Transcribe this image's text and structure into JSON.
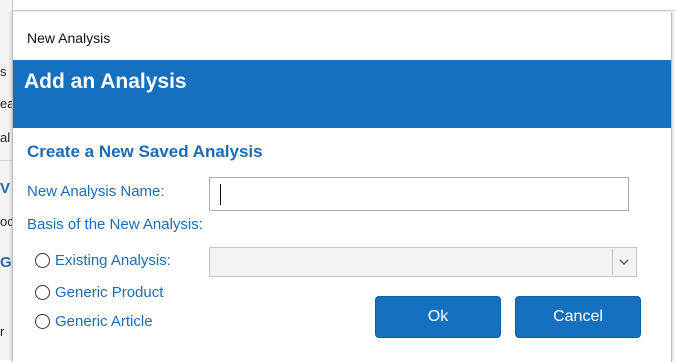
{
  "window": {
    "title": "New Analysis"
  },
  "header": {
    "title": "Add an Analysis"
  },
  "form": {
    "section_title": "Create a New Saved Analysis",
    "name_label": "New Analysis Name:",
    "name_value": "",
    "basis_label": "Basis of the New Analysis:",
    "options": [
      {
        "label": "Existing Analysis:",
        "selected": false
      },
      {
        "label": "Generic Product",
        "selected": false
      },
      {
        "label": "Generic Article",
        "selected": false
      }
    ],
    "existing_analysis_select": {
      "value": ""
    }
  },
  "buttons": {
    "ok": "Ok",
    "cancel": "Cancel"
  },
  "background": {
    "fragments": [
      "s",
      "ea",
      "al",
      "V",
      "oc",
      "G",
      "r"
    ]
  },
  "colors": {
    "accent": "#1570c0",
    "label": "#1a6cb8"
  },
  "icons": {
    "select_arrow": "chevron-down-icon",
    "radio": "radio-button-icon"
  }
}
